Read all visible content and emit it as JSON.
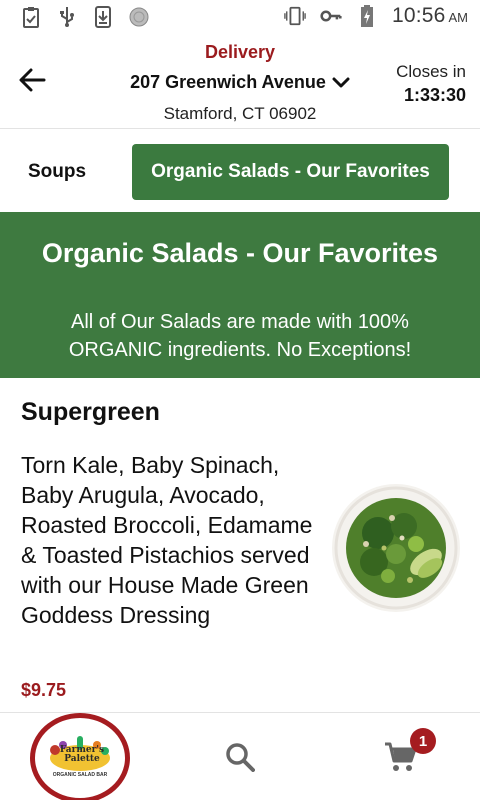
{
  "status_bar": {
    "icons": [
      "clipboard-icon",
      "usb-icon",
      "download-icon",
      "circle-icon",
      "vibrate-icon",
      "key-icon",
      "battery-charging-icon"
    ],
    "time": "10:56",
    "ampm": "AM"
  },
  "header": {
    "mode": "Delivery",
    "address_line1": "207 Greenwich Avenue",
    "address_line2": "Stamford, CT 06902",
    "closes_label": "Closes in",
    "closes_time": "1:33:30"
  },
  "tabs": [
    {
      "label": "Soups",
      "active": false
    },
    {
      "label": "Organic Salads - Our Favorites",
      "active": true
    }
  ],
  "banner": {
    "title": "Organic Salads - Our Favorites",
    "description": "All of Our Salads are made with 100% ORGANIC ingredients. No Exceptions!"
  },
  "item": {
    "name": "Supergreen",
    "description": "Torn Kale, Baby Spinach, Baby Arugula, Avocado, Roasted Broccoli, Edamame & Toasted Pistachios served with our House Made Green Goddess Dressing",
    "price": "$9.75"
  },
  "bottom_nav": {
    "logo_brand": "Farmer's Palette",
    "logo_tagline": "ORGANIC SALAD BAR",
    "cart_count": "1"
  },
  "colors": {
    "brand_red": "#9b1b1e",
    "green": "#3e7a40",
    "tab_green": "#3b7a3f"
  }
}
